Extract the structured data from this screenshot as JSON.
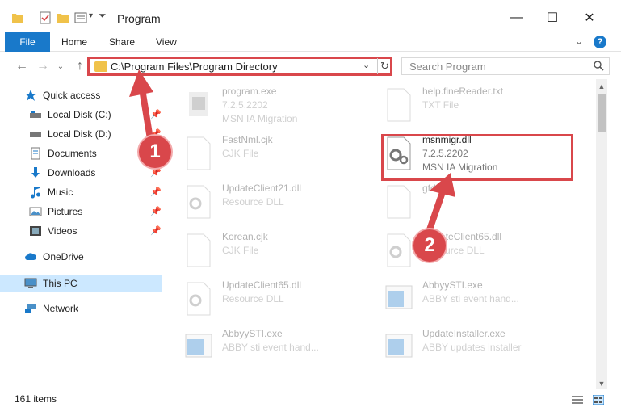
{
  "window": {
    "title": "Program",
    "minimize": "—",
    "maximize": "☐",
    "close": "✕"
  },
  "ribbon": {
    "file": "File",
    "tabs": [
      "Home",
      "Share",
      "View"
    ],
    "help": "?"
  },
  "address": {
    "path": "C:\\Program Files\\Program Directory",
    "search_placeholder": "Search Program"
  },
  "nav": {
    "items": [
      {
        "label": "Quick access",
        "icon": "star-icon",
        "pinned": false
      },
      {
        "label": "Local Disk (C:)",
        "icon": "drive-icon",
        "pinned": true
      },
      {
        "label": "Local Disk (D:)",
        "icon": "drive-icon",
        "pinned": true
      },
      {
        "label": "Documents",
        "icon": "document-icon",
        "pinned": true
      },
      {
        "label": "Downloads",
        "icon": "download-icon",
        "pinned": true
      },
      {
        "label": "Music",
        "icon": "music-icon",
        "pinned": true
      },
      {
        "label": "Pictures",
        "icon": "picture-icon",
        "pinned": true
      },
      {
        "label": "Videos",
        "icon": "video-icon",
        "pinned": true
      },
      {
        "label": "OneDrive",
        "icon": "cloud-icon",
        "pinned": false
      },
      {
        "label": "This PC",
        "icon": "computer-icon",
        "pinned": false
      },
      {
        "label": "Network",
        "icon": "network-icon",
        "pinned": false
      }
    ]
  },
  "files": [
    {
      "name": "program.exe",
      "line1": "7.2.5.2202",
      "line2": "MSN IA Migration",
      "icon": "exe-icon"
    },
    {
      "name": "help.fineReader.txt",
      "line1": "TXT File",
      "line2": "",
      "icon": "txt-icon"
    },
    {
      "name": "FastNml.cjk",
      "line1": "CJK File",
      "line2": "",
      "icon": "file-icon"
    },
    {
      "name": "msnmigr.dll",
      "line1": "7.2.5.2202",
      "line2": "MSN IA Migration",
      "icon": "dll-icon"
    },
    {
      "name": "UpdateClient21.dll",
      "line1": "Resource DLL",
      "line2": "",
      "icon": "dll-icon"
    },
    {
      "name": "gfdsk",
      "line1": "",
      "line2": "",
      "icon": "file-icon"
    },
    {
      "name": "Korean.cjk",
      "line1": "CJK File",
      "line2": "",
      "icon": "file-icon"
    },
    {
      "name": "UpdateClient65.dll",
      "line1": "Resource DLL",
      "line2": "",
      "icon": "dll-icon"
    },
    {
      "name": "UpdateClient65.dll",
      "line1": "Resource DLL",
      "line2": "",
      "icon": "dll-icon"
    },
    {
      "name": "AbbyySTI.exe",
      "line1": "ABBY sti event hand...",
      "line2": "",
      "icon": "app-icon"
    },
    {
      "name": "AbbyySTI.exe",
      "line1": "ABBY sti event hand...",
      "line2": "",
      "icon": "app-icon"
    },
    {
      "name": "UpdateInstaller.exe",
      "line1": "ABBY updates installer",
      "line2": "",
      "icon": "app-icon"
    }
  ],
  "status": {
    "count": "161 items"
  },
  "callouts": [
    "1",
    "2"
  ],
  "colors": {
    "accent": "#1979ca",
    "highlight": "#d9474b",
    "selection": "#cce8ff"
  }
}
